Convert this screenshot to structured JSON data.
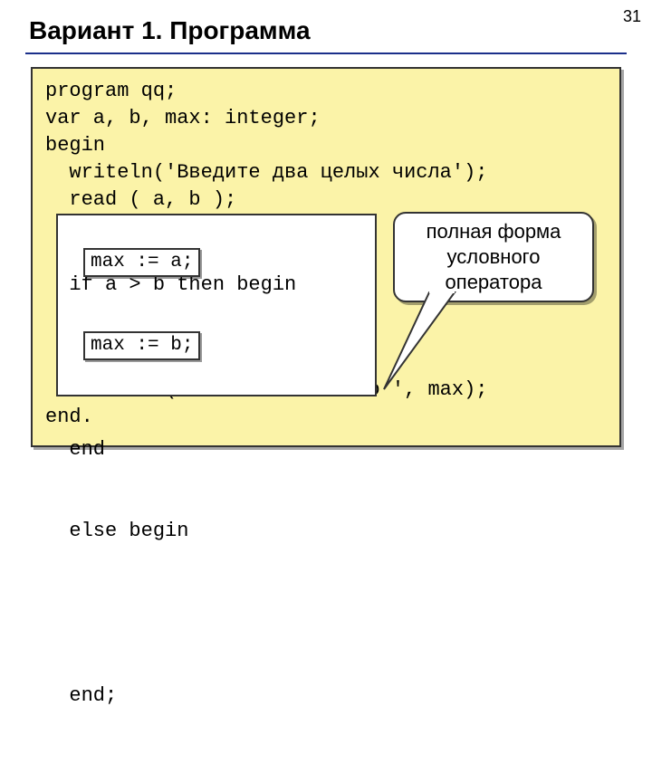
{
  "pageNumber": "31",
  "title": "Вариант 1. Программа",
  "code": {
    "l1": "program qq;",
    "l2": "var a, b, max: integer;",
    "l3": "begin",
    "l4": "  writeln('Введите два целых числа');",
    "l5": "  read ( a, b );",
    "l6a": "  if a > b then ",
    "l6b": "begin",
    "l7box": "max := a;",
    "l8": "  end",
    "l9a": "  else ",
    "l9b": "begin",
    "l10box": "max := b;",
    "l11": "  end;",
    "l12": "  writeln ('Наибольшее число ', max);",
    "l13": "end."
  },
  "callout": {
    "line1": "полная форма",
    "line2": "условного",
    "line3": "оператора"
  }
}
